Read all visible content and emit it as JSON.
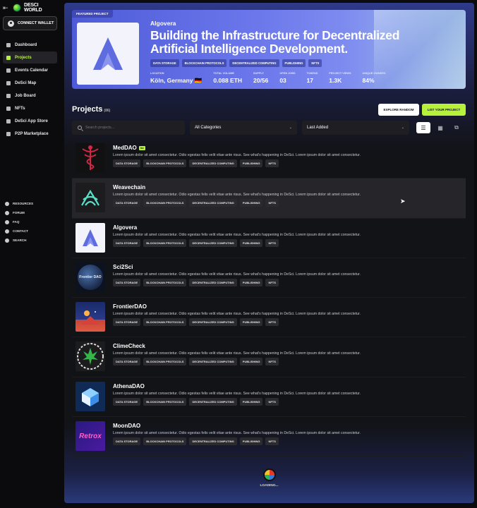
{
  "sidebar": {
    "back_icon": "arrow-left-icon",
    "logo_text_line1": "DESCI",
    "logo_text_line2": "WORLD",
    "connect_wallet": "CONNECT WALLET",
    "nav": [
      {
        "label": "Dashboard",
        "icon": "dashboard-icon"
      },
      {
        "label": "Projects",
        "icon": "projects-icon",
        "active": true
      },
      {
        "label": "Events Calendar",
        "icon": "calendar-icon"
      },
      {
        "label": "DeSci Map",
        "icon": "map-icon"
      },
      {
        "label": "Job Board",
        "icon": "jobboard-icon"
      },
      {
        "label": "NFTs",
        "icon": "nft-icon"
      },
      {
        "label": "DeSci App Store",
        "icon": "appstore-icon"
      },
      {
        "label": "P2P Marketplace",
        "icon": "marketplace-icon"
      }
    ],
    "secondary": [
      {
        "label": "RESOURCES"
      },
      {
        "label": "FORUM"
      },
      {
        "label": "FAQ"
      },
      {
        "label": "CONTACT"
      },
      {
        "label": "SEARCH"
      }
    ]
  },
  "featured": {
    "tag": "FEATURED PROJECT",
    "name": "Algovera",
    "headline": "Building the Infrastructure for Decentralized Artificial Intelligence Development.",
    "tags": [
      "DATA STORAGE",
      "BLOCKCHAIN PROTOCOLS",
      "DECENTRALIZED COMPUTING",
      "PUBLISHING",
      "NFTS"
    ],
    "stats": [
      {
        "label": "LOCATION",
        "value": "Köln, Germany 🇩🇪"
      },
      {
        "label": "TOTAL VOLUME",
        "value": "0.088 ETH"
      },
      {
        "label": "SUPPLY",
        "value": "20/56"
      },
      {
        "label": "OPEN JOBS",
        "value": "03"
      },
      {
        "label": "TOKENS",
        "value": "17"
      },
      {
        "label": "PROJECT VIEWS",
        "value": "1.3K"
      },
      {
        "label": "UNIQUE OWNERS",
        "value": "84%"
      }
    ]
  },
  "projects": {
    "title": "Projects",
    "count": "(86)",
    "explore_label": "EXPLORE RANDOM",
    "list_label": "LIST YOUR PROJECT",
    "search_placeholder": "Search projects...",
    "category_select": "All Categories",
    "sort_select": "Last Added",
    "items": [
      {
        "name": "MedDAO",
        "badge": "lsc",
        "desc": "Lorem ipsum dolor sit amet consectetur. Odio egestas felis velit vitae ante risus. See what's happening in DeSci. Lorem ipsum dolor sit amet consectetur.",
        "tags": [
          "DATA STORAGE",
          "BLOCKCHAIN PROTOCOLS",
          "DECENTRALIZED COMPUTING",
          "PUBLISHING",
          "NFTS"
        ]
      },
      {
        "name": "Weavechain",
        "desc": "Lorem ipsum dolor sit amet consectetur. Odio egestas felis velit vitae ante risus. See what's happening in DeSci. Lorem ipsum dolor sit amet consectetur.",
        "tags": [
          "DATA STORAGE",
          "BLOCKCHAIN PROTOCOLS",
          "DECENTRALIZED COMPUTING",
          "PUBLISHING",
          "NFTS"
        ]
      },
      {
        "name": "Algovera",
        "desc": "Lorem ipsum dolor sit amet consectetur. Odio egestas felis velit vitae ante risus. See what's happening in DeSci. Lorem ipsum dolor sit amet consectetur.",
        "tags": [
          "DATA STORAGE",
          "BLOCKCHAIN PROTOCOLS",
          "DECENTRALIZED COMPUTING",
          "PUBLISHING",
          "NFTS"
        ]
      },
      {
        "name": "Sci2Sci",
        "thumb_text": "Frontier DAO",
        "desc": "Lorem ipsum dolor sit amet consectetur. Odio egestas felis velit vitae ante risus. See what's happening in DeSci. Lorem ipsum dolor sit amet consectetur.",
        "tags": [
          "DATA STORAGE",
          "BLOCKCHAIN PROTOCOLS",
          "DECENTRALIZED COMPUTING",
          "PUBLISHING",
          "NFTS"
        ]
      },
      {
        "name": "FrontierDAO",
        "desc": "Lorem ipsum dolor sit amet consectetur. Odio egestas felis velit vitae ante risus. See what's happening in DeSci. Lorem ipsum dolor sit amet consectetur.",
        "tags": [
          "DATA STORAGE",
          "BLOCKCHAIN PROTOCOLS",
          "DECENTRALIZED COMPUTING",
          "PUBLISHING",
          "NFTS"
        ]
      },
      {
        "name": "ClimeCheck",
        "desc": "Lorem ipsum dolor sit amet consectetur. Odio egestas felis velit vitae ante risus. See what's happening in DeSci. Lorem ipsum dolor sit amet consectetur.",
        "tags": [
          "DATA STORAGE",
          "BLOCKCHAIN PROTOCOLS",
          "DECENTRALIZED COMPUTING",
          "PUBLISHING",
          "NFTS"
        ]
      },
      {
        "name": "AthenaDAO",
        "desc": "Lorem ipsum dolor sit amet consectetur. Odio egestas felis velit vitae ante risus. See what's happening in DeSci. Lorem ipsum dolor sit amet consectetur.",
        "tags": [
          "DATA STORAGE",
          "BLOCKCHAIN PROTOCOLS",
          "DECENTRALIZED COMPUTING",
          "PUBLISHING",
          "NFTS"
        ]
      },
      {
        "name": "MoonDAO",
        "thumb_text": "Retrox",
        "desc": "Lorem ipsum dolor sit amet consectetur. Odio egestas felis velit vitae ante risus. See what's happening in DeSci. Lorem ipsum dolor sit amet consectetur.",
        "tags": [
          "DATA STORAGE",
          "BLOCKCHAIN PROTOCOLS",
          "DECENTRALIZED COMPUTING",
          "PUBLISHING",
          "NFTS"
        ]
      }
    ]
  },
  "loading_text": "LOADING...",
  "colors": {
    "accent": "#b7f23a",
    "banner": "#5c68e0",
    "background": "#121316"
  }
}
